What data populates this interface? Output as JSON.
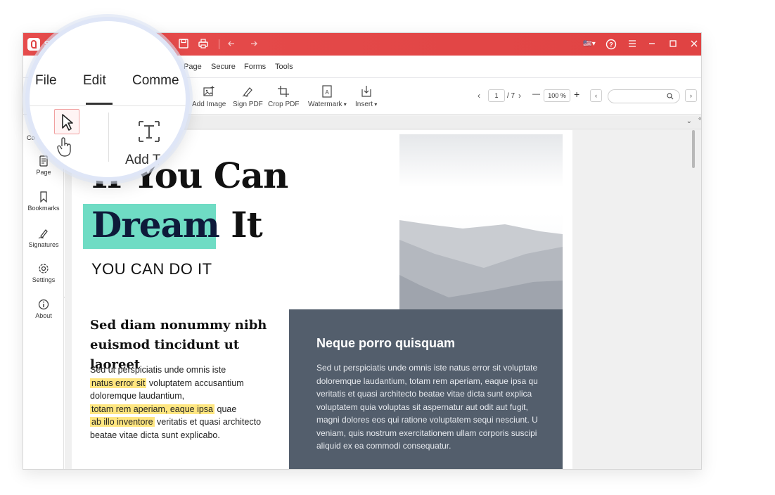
{
  "titlebar": {
    "app_initial": "S",
    "flag": "🇺🇸",
    "colors": {
      "brand": "#e04343",
      "white": "#ffffff"
    },
    "icons": [
      "save-icon",
      "print-icon",
      "undo-icon",
      "redo-icon",
      "language-flag-icon",
      "help-icon",
      "menu-icon",
      "minimize-icon",
      "maximize-icon",
      "close-icon"
    ]
  },
  "menubar": {
    "items": [
      "File",
      "Edit",
      "Comment",
      "Page",
      "Secure",
      "Forms",
      "Tools"
    ]
  },
  "lens": {
    "menu": [
      "File",
      "Edit",
      "Comme"
    ],
    "add_text_label": "Add Te"
  },
  "toolbar": {
    "tools": [
      {
        "label": "Add Image",
        "icon": "add-image-icon"
      },
      {
        "label": "Sign PDF",
        "icon": "sign-pdf-icon"
      },
      {
        "label": "Crop PDF",
        "icon": "crop-pdf-icon"
      },
      {
        "label": "Watermark",
        "icon": "watermark-icon",
        "dropdown": true
      },
      {
        "label": "Insert",
        "icon": "insert-icon",
        "dropdown": true
      }
    ],
    "page_current": "1",
    "page_total": "/ 7",
    "zoom": "100 %",
    "zoom_out": "—",
    "zoom_in": "+",
    "search_placeholder": ""
  },
  "sidebar": {
    "partial_label": "Co",
    "items": [
      {
        "label": "Page",
        "icon": "page-icon"
      },
      {
        "label": "Bookmarks",
        "icon": "bookmark-icon"
      },
      {
        "label": "Signatures",
        "icon": "signature-icon"
      },
      {
        "label": "Settings",
        "icon": "settings-icon"
      },
      {
        "label": "About",
        "icon": "info-icon"
      }
    ]
  },
  "document": {
    "hero_line1": "If You Can",
    "hero_highlight_word": "Dream",
    "hero_line2_rest": " It",
    "hero_sub": "YOU CAN DO IT",
    "left_heading": "Sed diam nonummy nibh euismod tincidunt ut laoreet",
    "left_body_1": "Sed ut perspiciatis unde omnis iste",
    "left_hl_1": "natus error sit",
    "left_body_2": " voluptatem accusantium doloremque laudantium,",
    "left_hl_2": "totam rem aperiam, eaque ipsa",
    "left_body_3": " quae",
    "left_hl_3": "ab illo inventore",
    "left_body_4": " veritatis et quasi architecto beatae vitae dicta sunt explicabo.",
    "panel_title": "Neque porro quisquam",
    "panel_lines": [
      "Sed ut perspiciatis unde omnis iste natus error sit voluptate",
      "doloremque laudantium, totam rem aperiam, eaque ipsa qu",
      "veritatis et quasi architecto beatae vitae dicta sunt explica",
      "voluptatem quia voluptas sit aspernatur aut odit aut fugit,",
      "magni dolores eos qui ratione voluptatem sequi nesciunt. U",
      "veniam, quis nostrum exercitationem ullam corporis suscipi",
      "aliquid ex ea commodi consequatur."
    ],
    "colors": {
      "highlight_teal": "#6fdcc4",
      "highlight_yellow": "#ffe680",
      "panel": "#535e6c"
    }
  }
}
